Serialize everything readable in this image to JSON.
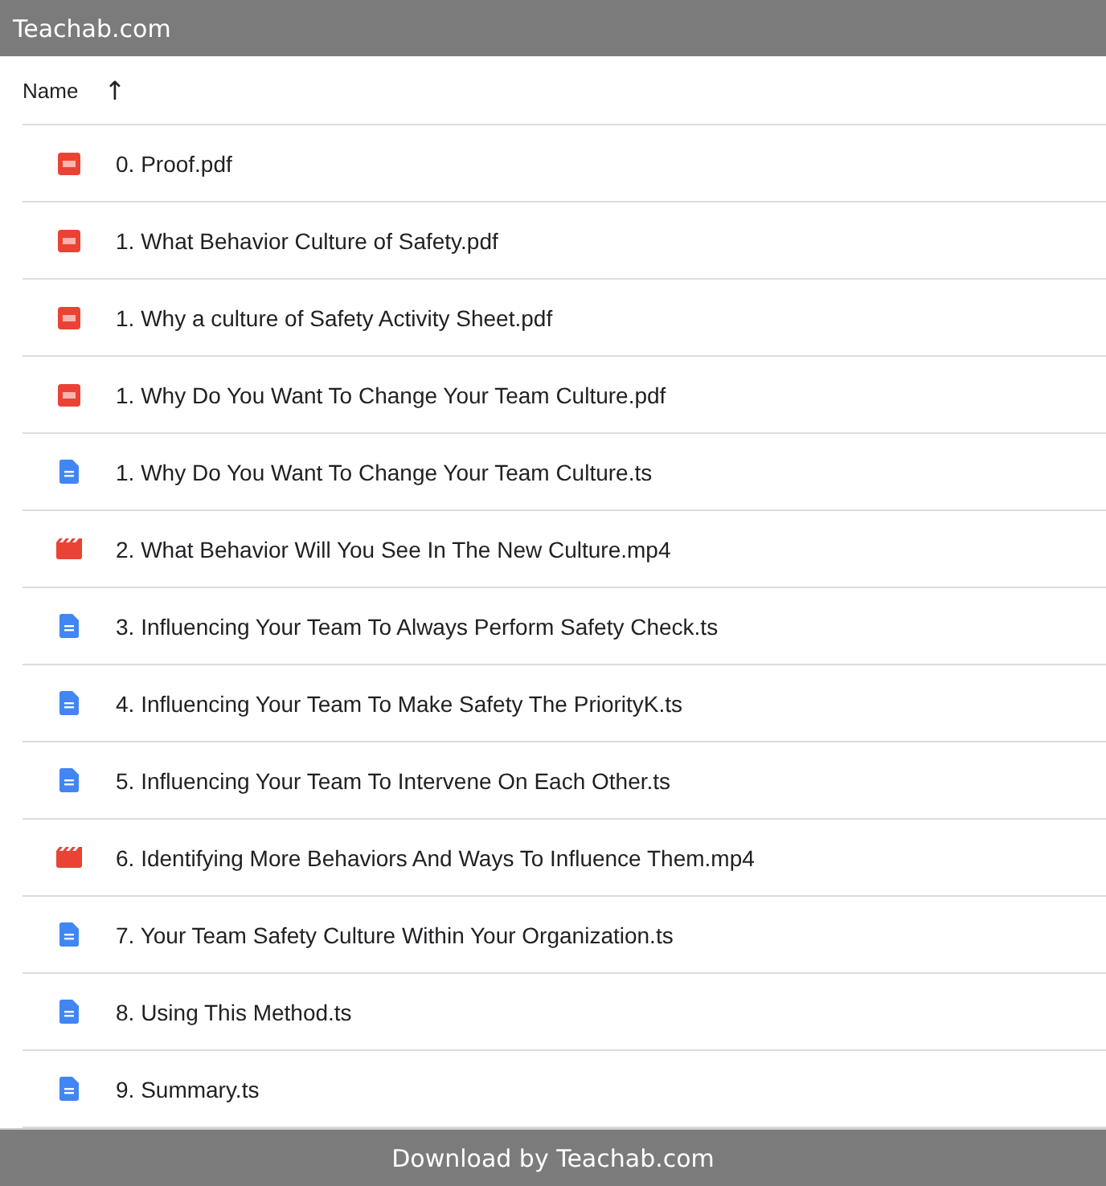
{
  "header": {
    "title": "Teachab.com"
  },
  "columns": [
    {
      "label": "Name",
      "sort_icon": "↑"
    }
  ],
  "files": [
    {
      "kind": "pdf",
      "name": "0. Proof.pdf"
    },
    {
      "kind": "pdf",
      "name": "1. What Behavior Culture of Safety.pdf"
    },
    {
      "kind": "pdf",
      "name": "1. Why a culture of Safety Activity Sheet.pdf"
    },
    {
      "kind": "pdf",
      "name": "1. Why Do You Want To Change Your Team Culture.pdf"
    },
    {
      "kind": "doc",
      "name": "1. Why Do You Want To Change Your Team Culture.ts"
    },
    {
      "kind": "video",
      "name": "2. What Behavior Will You See In The New Culture.mp4"
    },
    {
      "kind": "doc",
      "name": "3. Influencing Your Team To Always Perform Safety Check.ts"
    },
    {
      "kind": "doc",
      "name": "4. Influencing Your Team To Make Safety The PriorityK.ts"
    },
    {
      "kind": "doc",
      "name": "5. Influencing Your Team To Intervene On Each Other.ts"
    },
    {
      "kind": "video",
      "name": "6. Identifying More Behaviors And Ways To Influence Them.mp4"
    },
    {
      "kind": "doc",
      "name": "7. Your Team Safety Culture Within Your Organization.ts"
    },
    {
      "kind": "doc",
      "name": "8. Using This Method.ts"
    },
    {
      "kind": "doc",
      "name": "9. Summary.ts"
    }
  ],
  "footer": {
    "text": "Download by Teachab.com"
  }
}
